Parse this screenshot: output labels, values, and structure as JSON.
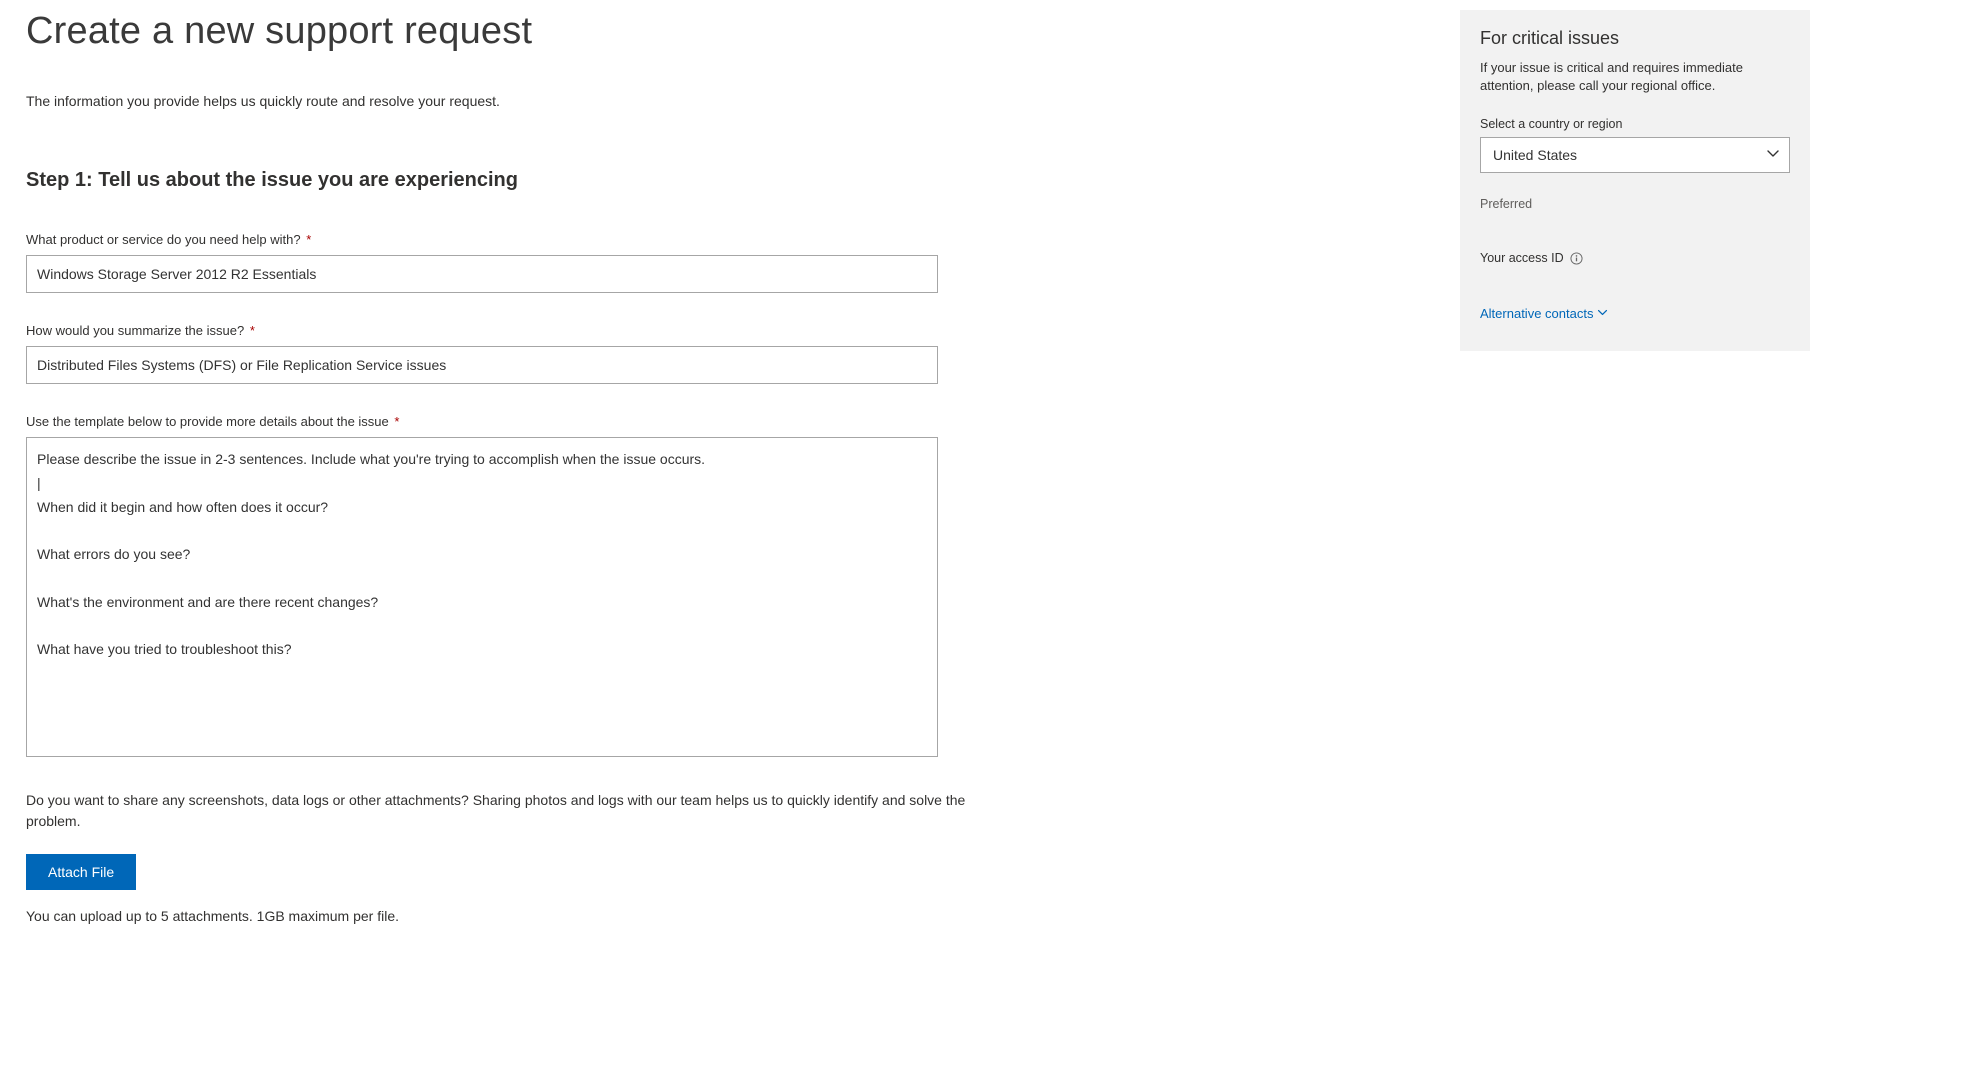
{
  "page": {
    "title": "Create a new support request",
    "intro": "The information you provide helps us quickly route and resolve your request."
  },
  "step1": {
    "heading": "Step 1: Tell us about the issue you are experiencing",
    "product_label": "What product or service do you need help with?",
    "product_value": "Windows Storage Server 2012 R2 Essentials",
    "summary_label": "How would you summarize the issue?",
    "summary_value": "Distributed Files Systems (DFS) or File Replication Service issues",
    "details_label": "Use the template below to provide more details about the issue",
    "details_value": "Please describe the issue in 2-3 sentences. Include what you're trying to accomplish when the issue occurs.\n|\nWhen did it begin and how often does it occur?\n\nWhat errors do you see?\n\nWhat's the environment and are there recent changes?\n\nWhat have you tried to troubleshoot this?",
    "attach_desc": "Do you want to share any screenshots, data logs or other attachments? Sharing photos and logs with our team helps us to quickly identify and solve the problem.",
    "attach_button": "Attach File",
    "attach_note": "You can upload up to 5 attachments. 1GB maximum per file."
  },
  "sidebar": {
    "heading": "For critical issues",
    "desc": "If your issue is critical and requires immediate attention, please call your regional office.",
    "country_label": "Select a country or region",
    "country_value": "United States",
    "preferred_label": "Preferred",
    "access_label": "Your access ID",
    "alt_contacts": "Alternative contacts"
  }
}
